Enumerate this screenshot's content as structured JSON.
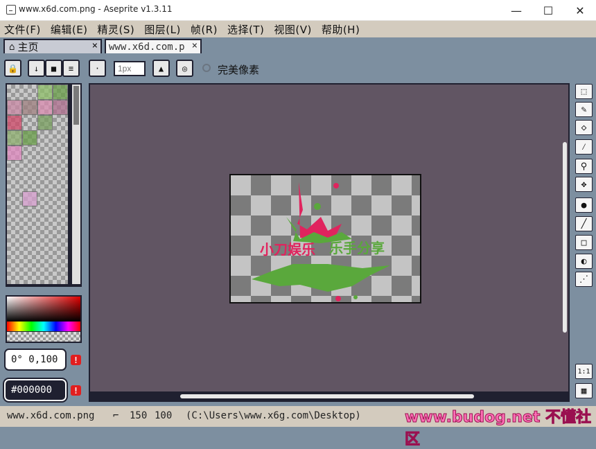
{
  "window": {
    "title": "www.x6d.com.png - Aseprite v1.3.11",
    "min_icon": "minimize-icon",
    "max_icon": "maximize-icon",
    "close_icon": "close-icon",
    "min_glyph": "—",
    "max_glyph": "☐",
    "close_glyph": "✕"
  },
  "menu": [
    "文件(F)",
    "编辑(E)",
    "精灵(S)",
    "图层(L)",
    "帧(R)",
    "选择(T)",
    "视图(V)",
    "帮助(H)"
  ],
  "tabs": [
    {
      "label": "主页",
      "icon": "home-icon",
      "icon_glyph": "⌂",
      "close": "×"
    },
    {
      "label": "www.x6d.com.p",
      "close": "×"
    }
  ],
  "toolbar": {
    "brush_size_placeholder": "1px",
    "pixel_perfect_label": "完美像素",
    "glyph_lock": "🔒",
    "glyph_down": "↓",
    "glyph_square": "■",
    "glyph_menu": "≡",
    "glyph_dot": "·",
    "glyph_ink": "▲",
    "glyph_zoom": "◎"
  },
  "color": {
    "hsv_value": "0° 0,100",
    "hex_value": "#000000",
    "warn": "!"
  },
  "palette_swatches": [
    "#c9c9c9",
    "#999999",
    "#8fbf6a",
    "#6a9f4a",
    "#c98aa6",
    "#9f8080",
    "#d98cb0",
    "#b07090",
    "#d04a6a",
    "#999999",
    "#7aa060",
    "#c9c9c9",
    "#8fb070",
    "#6a9f4a",
    "#c9c9c9",
    "#999999",
    "#e08ac0",
    "#c9c9c9",
    "#999999",
    "#c9c9c9",
    "#c9c9c9",
    "#999999",
    "#c9c9c9",
    "#999999",
    "#999999",
    "#c9c9c9",
    "#999999",
    "#c9c9c9",
    "#c9c9c9",
    "#d8a0d0",
    "#c9c9c9",
    "#999999",
    "#999999",
    "#c9c9c9",
    "#999999",
    "#c9c9c9",
    "#c9c9c9",
    "#999999",
    "#c9c9c9",
    "#999999",
    "#999999",
    "#c9c9c9",
    "#999999",
    "#c9c9c9",
    "#c9c9c9",
    "#999999",
    "#c9c9c9",
    "#999999",
    "#999999",
    "#c9c9c9",
    "#999999",
    "#c9c9c9"
  ],
  "sprite": {
    "text_left": "小刀娱乐",
    "text_right": "乐手分享",
    "accent_red": "#e0245e",
    "accent_green": "#5aa83c"
  },
  "tools": [
    {
      "name": "marquee-tool",
      "glyph": "⬚"
    },
    {
      "name": "pencil-tool",
      "glyph": "✎"
    },
    {
      "name": "eraser-tool",
      "glyph": "◇"
    },
    {
      "name": "eyedropper-tool",
      "glyph": "⁄"
    },
    {
      "name": "zoom-tool",
      "glyph": "⚲"
    },
    {
      "name": "move-tool",
      "glyph": "✥"
    },
    {
      "name": "fill-tool",
      "glyph": "●"
    },
    {
      "name": "line-tool",
      "glyph": "╱"
    },
    {
      "name": "rectangle-tool",
      "glyph": "□"
    },
    {
      "name": "contour-tool",
      "glyph": "◐"
    },
    {
      "name": "spray-tool",
      "glyph": "⋰"
    }
  ],
  "view_buttons": [
    {
      "name": "zoom-1to1-button",
      "glyph": "1:1"
    },
    {
      "name": "timeline-button",
      "glyph": "▦"
    }
  ],
  "status": {
    "filename": "www.x6d.com.png",
    "size_icon": "canvas-size-icon",
    "size_glyph": "⌐",
    "width": "150",
    "height": "100",
    "path": "(C:\\Users\\www.x6g.com\\Desktop)",
    "watermark": "www.budog.net 不懂社区"
  }
}
